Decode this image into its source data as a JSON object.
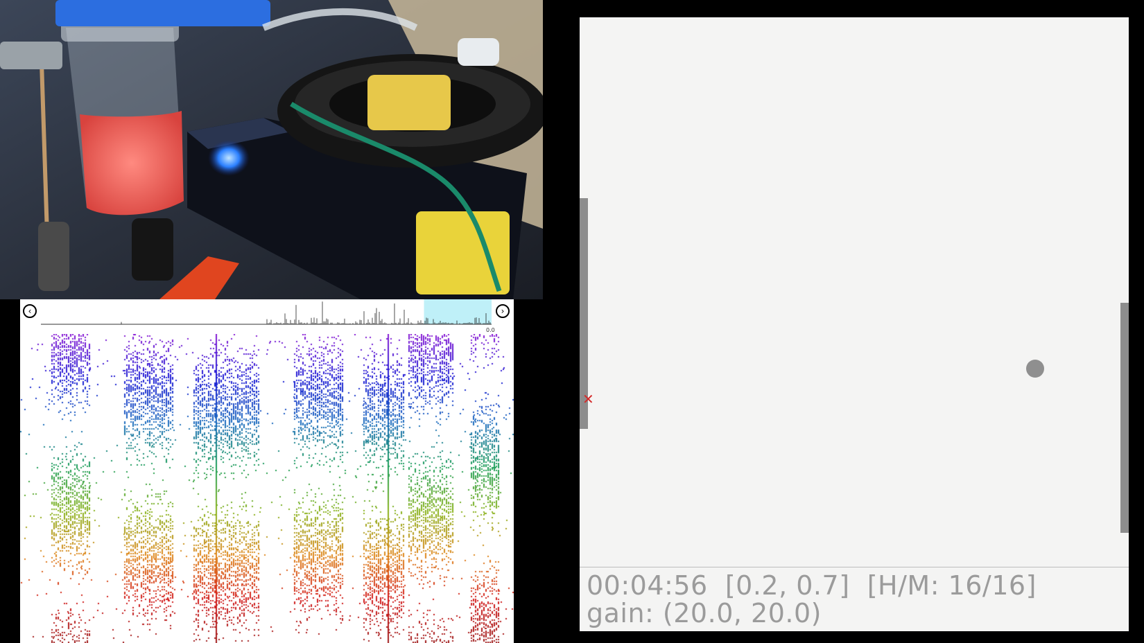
{
  "status": {
    "elapsed": "00:04:56",
    "position": "[0.2, 0.7]",
    "hits_misses": "[H/M: 16/16]",
    "gain": "gain: (20.0, 20.0)"
  },
  "timeline": {
    "end_label": "0.0",
    "highlight_range": [
      0.85,
      1.0
    ]
  },
  "game_state": {
    "ball_position": [
      0.83,
      0.64
    ],
    "left_paddle_center": 0.54,
    "right_paddle_center": 0.73,
    "paddle_extent": 0.42
  },
  "icons": {
    "prev": "chevron-left-circle-icon",
    "next": "chevron-right-circle-icon",
    "miss_marker": "cross-mark-icon"
  },
  "colors": {
    "game_background": "#f4f4f3",
    "paddle": "#8d8d8d",
    "ball": "#8f8f8f",
    "miss_marker": "#d42a2a",
    "status_text": "#9b9b9b",
    "timeline_highlight": "#bff0f8",
    "raster_gradient": [
      "#8a1fd6",
      "#1f1fd6",
      "#1f6fc0",
      "#1fa05a",
      "#8ab41f",
      "#e08a1f",
      "#d41f1f",
      "#a01f1f"
    ]
  },
  "glyphs": {
    "prev": "‹",
    "next": "›",
    "miss": "✕"
  }
}
